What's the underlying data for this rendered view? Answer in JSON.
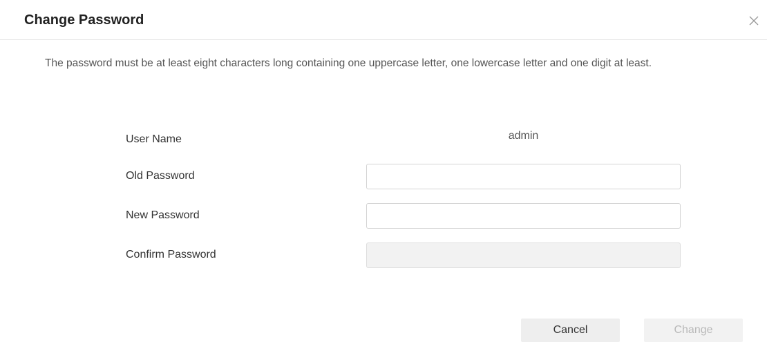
{
  "dialog": {
    "title": "Change Password",
    "close_icon": "close-icon",
    "notice": "The password must be at least eight characters long containing one uppercase letter, one lowercase letter and one digit at least."
  },
  "form": {
    "username_label": "User Name",
    "username_value": "admin",
    "old_password_label": "Old Password",
    "old_password_value": "",
    "new_password_label": "New Password",
    "new_password_value": "",
    "confirm_password_label": "Confirm Password",
    "confirm_password_value": "",
    "confirm_password_disabled": true
  },
  "buttons": {
    "cancel_label": "Cancel",
    "change_label": "Change",
    "change_disabled": true
  },
  "colors": {
    "title": "#222222",
    "text": "#333333",
    "muted_text": "#555555",
    "divider": "#e4e4e4",
    "input_border": "#d4d4d4",
    "disabled_bg": "#f2f2f2",
    "cancel_bg": "#eeeeee",
    "disabled_text": "#b9b9b9"
  }
}
